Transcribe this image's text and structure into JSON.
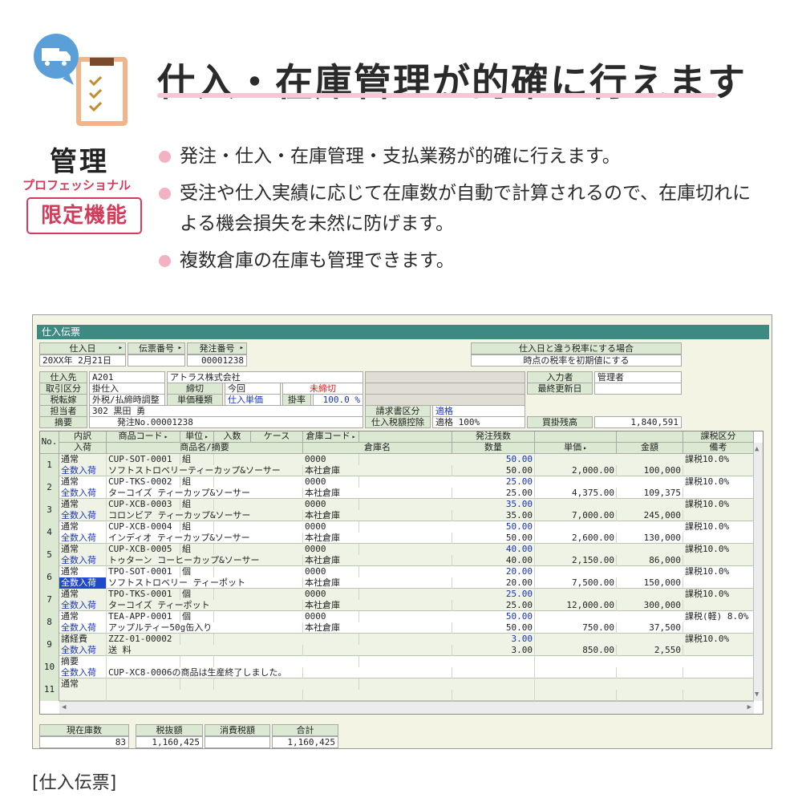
{
  "hero": {
    "title": "仕入・在庫管理が的確に行えます",
    "badge_kanri": "管理",
    "badge_pro": "プロフェッショナル",
    "badge_limited": "限定機能",
    "features": [
      "発注・仕入・在庫管理・支払業務が的確に行えます。",
      "受注や仕入実績に応じて在庫数が自動で計算されるので、在庫切れによる機会損失を未然に防げます。",
      "複数倉庫の在庫も管理できます。"
    ]
  },
  "window": {
    "title": "仕入伝票",
    "labels": {
      "shiire_bi": "仕入日",
      "denpyo_no": "伝票番号",
      "hacchu_no": "発注番号",
      "zeiritsu_title": "仕入日と違う税率にする場合",
      "zeiritsu_desc": "時点の税率を初期値にする",
      "shiiresaki": "仕入先",
      "torihiki": "取引区分",
      "shimekiri": "締切",
      "zeitenka": "税転嫁",
      "tanka_shubetsu": "単価種類",
      "kakeritsu": "掛率",
      "tantosha": "担当者",
      "tekiyo": "摘要",
      "seikyusho": "請求書区分",
      "koujo": "仕入税額控除",
      "nyuryokusha": "入力者",
      "saishu": "最終更新日",
      "kaikake": "買掛残高"
    },
    "values": {
      "shiire_bi": "20XX年 2月21日",
      "hacchu_no": "00001238",
      "shiiresaki_code": "A201",
      "shiiresaki_name": "アトラス株式会社",
      "torihiki": "掛仕入",
      "shimekiri": "今回",
      "shimekiri_status": "未締切",
      "zeitenka": "外税/払締時調整",
      "tanka_shubetsu": "仕入単価",
      "kakeritsu": "100.0 %",
      "tantosha": "302 黒田 勇",
      "tekiyo": "発注No.00001238",
      "seikyusho": "適格",
      "koujo": "適格 100%",
      "nyuryokusha": "管理者",
      "kaikake": "1,840,591"
    },
    "grid": {
      "header_row1": [
        "No.",
        "内訳",
        "商品コード",
        "単位",
        "入数",
        "ケース",
        "倉庫コード",
        "",
        "発注残数",
        "",
        "",
        "課税区分"
      ],
      "header_row2": [
        "入荷",
        "商品名/摘要",
        "倉庫名",
        "数量",
        "単価",
        "金額",
        "備考"
      ],
      "rows": [
        {
          "no": "1",
          "kind": "通常",
          "nyuka": "全数入荷",
          "code": "CUP-SOT-0001",
          "unit": "組",
          "name": "ソフトストロベリーティーカップ&ソーサー",
          "wh_code": "0000",
          "wh_name": "本社倉庫",
          "zan": "50.00",
          "qty": "50.00",
          "price": "2,000.00",
          "amount": "100,000",
          "tax": "課税10.0%"
        },
        {
          "no": "2",
          "kind": "通常",
          "nyuka": "全数入荷",
          "code": "CUP-TKS-0002",
          "unit": "組",
          "name": "ターコイズ ティーカップ&ソーサー",
          "wh_code": "0000",
          "wh_name": "本社倉庫",
          "zan": "25.00",
          "qty": "25.00",
          "price": "4,375.00",
          "amount": "109,375",
          "tax": "課税10.0%"
        },
        {
          "no": "3",
          "kind": "通常",
          "nyuka": "全数入荷",
          "code": "CUP-XCB-0003",
          "unit": "組",
          "name": "コロンビア ティーカップ&ソーサー",
          "wh_code": "0000",
          "wh_name": "本社倉庫",
          "zan": "35.00",
          "qty": "35.00",
          "price": "7,000.00",
          "amount": "245,000",
          "tax": "課税10.0%"
        },
        {
          "no": "4",
          "kind": "通常",
          "nyuka": "全数入荷",
          "code": "CUP-XCB-0004",
          "unit": "組",
          "name": "インディオ ティーカップ&ソーサー",
          "wh_code": "0000",
          "wh_name": "本社倉庫",
          "zan": "50.00",
          "qty": "50.00",
          "price": "2,600.00",
          "amount": "130,000",
          "tax": "課税10.0%"
        },
        {
          "no": "5",
          "kind": "通常",
          "nyuka": "全数入荷",
          "code": "CUP-XCB-0005",
          "unit": "組",
          "name": "トゥターン コーヒーカップ&ソーサー",
          "wh_code": "0000",
          "wh_name": "本社倉庫",
          "zan": "40.00",
          "qty": "40.00",
          "price": "2,150.00",
          "amount": "86,000",
          "tax": "課税10.0%"
        },
        {
          "no": "6",
          "kind": "通常",
          "nyuka": "全数入荷",
          "code": "TPO-SOT-0001",
          "unit": "個",
          "name": "ソフトストロベリー ティーポット",
          "wh_code": "0000",
          "wh_name": "本社倉庫",
          "zan": "20.00",
          "qty": "20.00",
          "price": "7,500.00",
          "amount": "150,000",
          "tax": "課税10.0%"
        },
        {
          "no": "7",
          "kind": "通常",
          "nyuka": "全数入荷",
          "code": "TPO-TKS-0001",
          "unit": "個",
          "name": "ターコイズ ティーポット",
          "wh_code": "0000",
          "wh_name": "本社倉庫",
          "zan": "25.00",
          "qty": "25.00",
          "price": "12,000.00",
          "amount": "300,000",
          "tax": "課税10.0%"
        },
        {
          "no": "8",
          "kind": "通常",
          "nyuka": "全数入荷",
          "code": "TEA-APP-0001",
          "unit": "個",
          "name": "アップルティー50g缶入り",
          "wh_code": "0000",
          "wh_name": "本社倉庫",
          "zan": "50.00",
          "qty": "50.00",
          "price": "750.00",
          "amount": "37,500",
          "tax": "課税(軽) 8.0%"
        },
        {
          "no": "9",
          "kind": "諸経費",
          "nyuka": "全数入荷",
          "code": "ZZZ-01-00002",
          "unit": "",
          "name": "送 料",
          "wh_code": "",
          "wh_name": "",
          "zan": "3.00",
          "qty": "3.00",
          "price": "850.00",
          "amount": "2,550",
          "tax": "課税10.0%"
        },
        {
          "no": "10",
          "kind": "摘要",
          "nyuka": "全数入荷",
          "code": "",
          "unit": "",
          "name": "CUP-XC8-0006の商品は生産終了しました。",
          "wh_code": "",
          "wh_name": "",
          "zan": "",
          "qty": "",
          "price": "",
          "amount": "",
          "tax": ""
        },
        {
          "no": "11",
          "kind": "通常",
          "nyuka": "",
          "code": "",
          "unit": "",
          "name": "",
          "wh_code": "",
          "wh_name": "",
          "zan": "",
          "qty": "",
          "price": "",
          "amount": "",
          "tax": ""
        }
      ]
    },
    "totals": {
      "labels": [
        "現在庫数",
        "税抜額",
        "消費税額",
        "合計"
      ],
      "values": [
        "83",
        "1,160,425",
        "",
        "1,160,425"
      ]
    }
  },
  "caption": "[仕入伝票]"
}
